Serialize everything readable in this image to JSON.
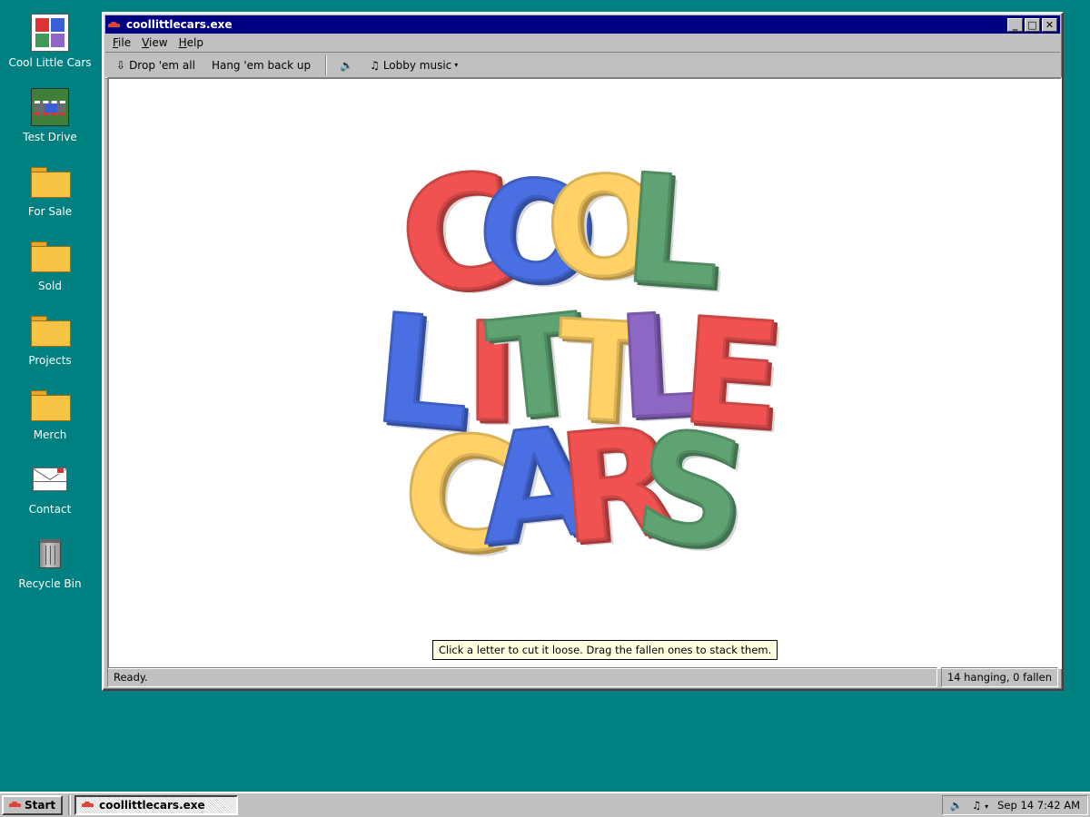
{
  "desktop": {
    "icons": [
      {
        "label": "Cool Little Cars",
        "icon": "cool-little-cars-logo-icon"
      },
      {
        "label": "Test Drive",
        "icon": "test-drive-icon"
      },
      {
        "label": "For Sale",
        "icon": "folder-icon"
      },
      {
        "label": "Sold",
        "icon": "folder-icon"
      },
      {
        "label": "Projects",
        "icon": "folder-icon"
      },
      {
        "label": "Merch",
        "icon": "folder-icon"
      },
      {
        "label": "Contact",
        "icon": "envelope-icon"
      },
      {
        "label": "Recycle Bin",
        "icon": "recycle-bin-icon"
      }
    ]
  },
  "window": {
    "title": "coollittlecars.exe",
    "buttons": {
      "minimize": "_",
      "maximize": "□",
      "close": "✕"
    },
    "menu": [
      {
        "accel": "F",
        "rest": "ile"
      },
      {
        "accel": "V",
        "rest": "iew"
      },
      {
        "accel": "H",
        "rest": "elp"
      }
    ],
    "toolbar": {
      "drop_label": "Drop 'em all",
      "drop_icon": "⇩",
      "hang_label": "Hang 'em back up",
      "sound_icon": "🔈",
      "music_icon": "♫",
      "music_label": "Lobby music",
      "music_caret": "▾"
    },
    "tooltip": "Click a letter to cut it loose. Drag the fallen ones to stack them.",
    "status": {
      "left": "Ready.",
      "right": "14 hanging, 0 fallen"
    },
    "logo": {
      "letters": [
        {
          "ch": "C",
          "color": "#f05252"
        },
        {
          "ch": "O",
          "color": "#4a6fe3"
        },
        {
          "ch": "O",
          "color": "#ffd166"
        },
        {
          "ch": "L",
          "color": "#5fa372"
        },
        {
          "ch": "L",
          "color": "#4a6fe3"
        },
        {
          "ch": "I",
          "color": "#f05252"
        },
        {
          "ch": "T",
          "color": "#5fa372"
        },
        {
          "ch": "T",
          "color": "#ffd166"
        },
        {
          "ch": "L",
          "color": "#8e67c4"
        },
        {
          "ch": "E",
          "color": "#f05252"
        },
        {
          "ch": "C",
          "color": "#ffd166"
        },
        {
          "ch": "A",
          "color": "#4a6fe3"
        },
        {
          "ch": "R",
          "color": "#f05252"
        },
        {
          "ch": "S",
          "color": "#5fa372"
        }
      ]
    }
  },
  "taskbar": {
    "start_label": "Start",
    "task_label": "coollittlecars.exe",
    "tray": {
      "volume_icon": "🔈",
      "music_icon": "♫",
      "music_caret": "▾",
      "clock": "Sep 14  7:42 AM"
    }
  }
}
